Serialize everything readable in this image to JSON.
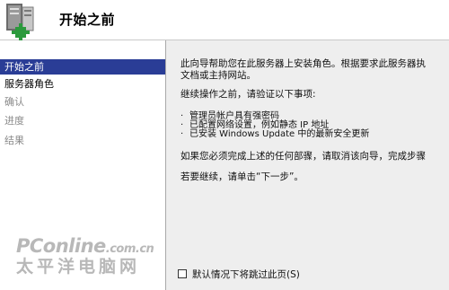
{
  "header": {
    "title": "开始之前",
    "icon": "server-role-wizard-icon"
  },
  "sidebar": {
    "items": [
      {
        "label": "开始之前",
        "state": "active"
      },
      {
        "label": "服务器角色",
        "state": "enabled"
      },
      {
        "label": "确认",
        "state": "disabled"
      },
      {
        "label": "进度",
        "state": "disabled"
      },
      {
        "label": "结果",
        "state": "disabled"
      }
    ]
  },
  "content": {
    "intro_line1": "此向导帮助您在此服务器上安装角色。根据要求此服务器执",
    "intro_line2": "文档或主持网站。",
    "continue_heading": "继续操作之前，请验证以下事项:",
    "bullets": [
      "管理员帐户具有强密码",
      "已配置网络设置，例如静态 IP 地址",
      "已安装 Windows Update 中的最新安全更新"
    ],
    "cancel_note": "如果您必须完成上述的任何部骤，请取消该向导，完成步骤",
    "next_note": "若要继续，请单击“下一步”。"
  },
  "watermark": {
    "brand": "PConline",
    "domain": ".com.cn",
    "cn": "太平洋电脑网"
  },
  "footer": {
    "skip_label": "默认情况下将跳过此页(S)",
    "skip_checked": false
  },
  "colors": {
    "active_bg": "#2a3d96",
    "content_bg": "#eeeeee",
    "disabled_text": "#8a8a8a"
  }
}
